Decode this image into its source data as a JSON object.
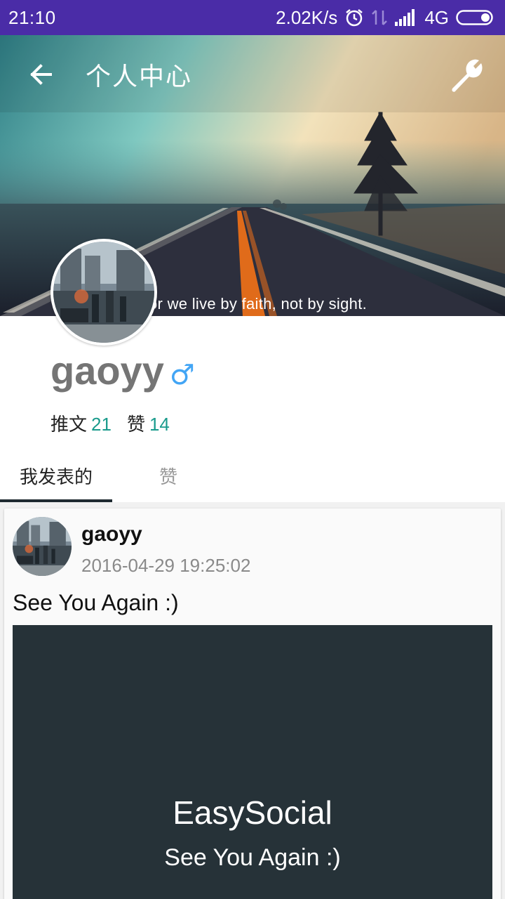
{
  "status_bar": {
    "time": "21:10",
    "network_speed": "2.02K/s",
    "network_type": "4G",
    "icons": [
      "alarm-icon",
      "data-transfer-icon",
      "signal-icon",
      "battery-icon"
    ]
  },
  "toolbar": {
    "title": "个人中心",
    "back_icon": "arrow-left-icon",
    "settings_icon": "wrench-icon"
  },
  "cover": {
    "quote": "or we live by faith, not by sight."
  },
  "profile": {
    "username": "gaoyy",
    "gender_symbol": "♂",
    "stats": [
      {
        "label": "推文",
        "value": "21"
      },
      {
        "label": "赞",
        "value": "14"
      }
    ]
  },
  "tabs": [
    {
      "label": "我发表的",
      "active": true
    },
    {
      "label": "赞",
      "active": false
    }
  ],
  "post": {
    "username": "gaoyy",
    "timestamp": "2016-04-29 19:25:02",
    "text": "See You Again :)",
    "image_title": "EasySocial",
    "image_subtitle": "See You Again :)"
  },
  "colors": {
    "status_bar": "#4a2ca7",
    "accent_number": "#1a9b8c",
    "gender": "#42a5f5",
    "tab_indicator": "#1e2a30",
    "post_image_bg": "#263238"
  }
}
